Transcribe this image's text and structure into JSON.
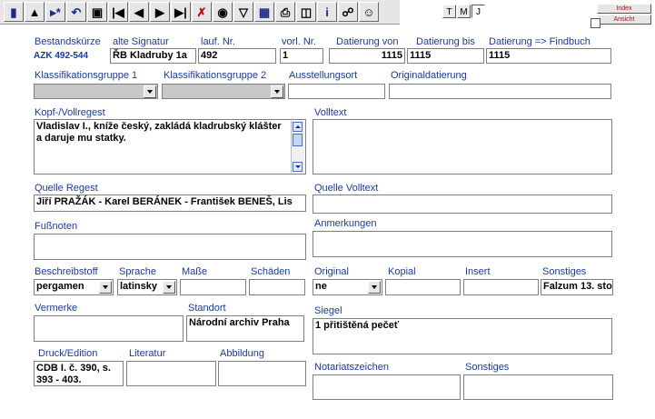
{
  "toolbar": {
    "icons": [
      "book-icon",
      "home-icon",
      "first-new-icon",
      "undo-icon",
      "save-icon",
      "first-record-icon",
      "previous-record-icon",
      "next-record-icon",
      "last-record-icon",
      "delete-filter-icon",
      "find-icon",
      "filter-icon",
      "table-icon",
      "print-icon",
      "copy-record-icon",
      "info-icon",
      "tree-icon",
      "palette-icon"
    ],
    "view_buttons": [
      "T",
      "M",
      "J"
    ]
  },
  "side_buttons": {
    "index": "Index",
    "ansicht": "Ansicht"
  },
  "labels": {
    "bestandskuerze": "Bestandskürze",
    "alte_signatur": "alte Signatur",
    "lauf_nr": "lauf. Nr.",
    "vorl_nr": "vorl. Nr.",
    "datierung_von": "Datierung von",
    "datierung_bis": "Datierung bis",
    "datierung_findbuch": "Datierung => Findbuch",
    "klass1": "Klassifikationsgruppe 1",
    "klass2": "Klassifikationsgruppe 2",
    "ausstellungsort": "Ausstellungsort",
    "originaldatierung": "Originaldatierung",
    "kopf_vollregest": "Kopf-/Vollregest",
    "volltext": "Volltext",
    "quelle_regest": "Quelle Regest",
    "quelle_volltext": "Quelle Volltext",
    "fussnoten": "Fußnoten",
    "anmerkungen": "Anmerkungen",
    "beschreibstoff": "Beschreibstoff",
    "sprache": "Sprache",
    "masse": "Maße",
    "schaeden": "Schäden",
    "original": "Original",
    "kopial": "Kopial",
    "insert": "Insert",
    "sonstiges": "Sonstiges",
    "vermerke": "Vermerke",
    "standort": "Standort",
    "siegel": "Siegel",
    "druck_edition": "Druck/Edition",
    "literatur": "Literatur",
    "abbildung": "Abbildung",
    "notariatszeichen": "Notariatszeichen",
    "sonstiges2": "Sonstiges"
  },
  "values": {
    "bestandskuerze": "AZK 492-544",
    "alte_signatur": "ŘB Kladruby 1a",
    "lauf_nr": "492",
    "vorl_nr": "1",
    "datierung_von": "1115",
    "datierung_bis": "1115",
    "datierung_findbuch": "1115",
    "kopf_vollregest": "Vladislav I., kníže český, zakládá kladrubský klášter a daruje mu statky.",
    "quelle_regest": "Jiří PRAŽÁK - Karel BERÁNEK - František BENEŠ, Lis",
    "beschreibstoff": "pergamen",
    "sprache": "latinsky",
    "original": "ne",
    "sonstiges": "Falzum 13. sto",
    "standort": "Národní archiv Praha",
    "siegel": "1 přitištěná pečeť",
    "druck_edition": "CDB I. č. 390, s. 393 - 403."
  }
}
